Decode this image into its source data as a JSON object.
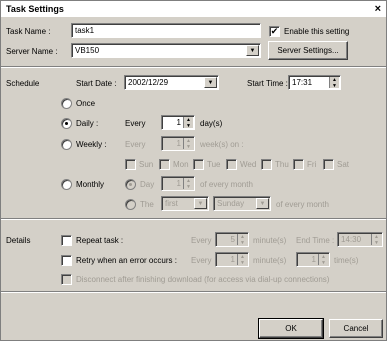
{
  "window": {
    "title": "Task Settings",
    "close_glyph": "×"
  },
  "task": {
    "name_label": "Task Name :",
    "name_value": "task1",
    "enable_label": "Enable this setting",
    "enable_checked": "✔",
    "server_label": "Server Name :",
    "server_value": "VB150",
    "server_settings_label": "Server Settings..."
  },
  "schedule": {
    "section_label": "Schedule",
    "start_date_label": "Start Date :",
    "start_date_value": "2002/12/29",
    "start_time_label": "Start Time :",
    "start_time_value": "17:31",
    "once_label": "Once",
    "daily_label": "Daily :",
    "daily_every": "Every",
    "daily_value": "1",
    "daily_unit": "day(s)",
    "weekly_label": "Weekly :",
    "weekly_every": "Every",
    "weekly_value": "1",
    "weekly_unit": "week(s) on :",
    "days": [
      "Sun",
      "Mon",
      "Tue",
      "Wed",
      "Thu",
      "Fri",
      "Sat"
    ],
    "monthly_label": "Monthly",
    "monthly_day_label": "Day",
    "monthly_day_value": "1",
    "monthly_day_suffix": "of every month",
    "monthly_the_label": "The",
    "monthly_ordinal": "first",
    "monthly_weekday": "Sunday",
    "monthly_the_suffix": "of every month"
  },
  "details": {
    "section_label": "Details",
    "repeat_label": "Repeat task :",
    "repeat_every": "Every",
    "repeat_value": "5",
    "repeat_unit": "minute(s)",
    "end_time_label": "End Time :",
    "end_time_value": "14:30",
    "retry_label": "Retry when an error occurs :",
    "retry_every": "Every",
    "retry_value": "1",
    "retry_unit": "minute(s)",
    "retry_times_value": "1",
    "retry_times_unit": "time(s)",
    "disconnect_label": "Disconnect after finishing download (for access via dial-up connections)"
  },
  "buttons": {
    "ok": "OK",
    "cancel": "Cancel"
  },
  "icons": {
    "spin_up": "▲",
    "spin_down": "▼",
    "dropdown": "▼"
  }
}
